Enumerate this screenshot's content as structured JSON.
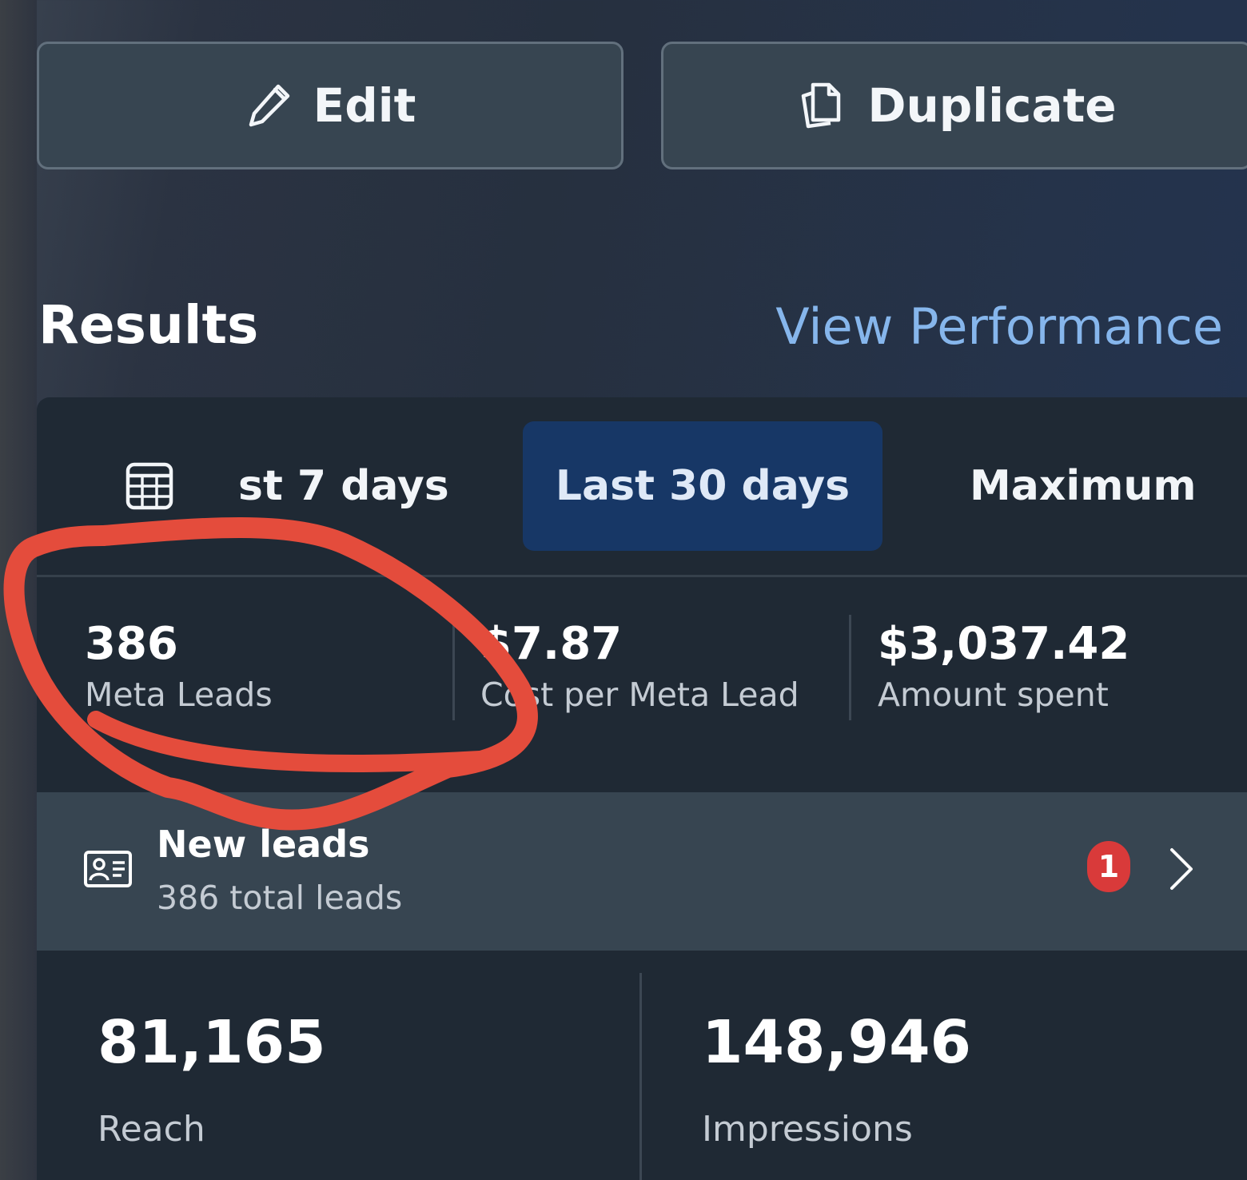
{
  "actions": {
    "edit_label": "Edit",
    "duplicate_label": "Duplicate"
  },
  "results": {
    "title": "Results",
    "view_performance": "View Performance"
  },
  "date_tabs": {
    "last7": "st 7 days",
    "last30": "Last 30 days",
    "maximum": "Maximum",
    "selected": "Last 30 days"
  },
  "metrics": {
    "meta_leads": {
      "value": "386",
      "label": "Meta Leads"
    },
    "cost_per_lead": {
      "value": "$7.87",
      "label": "Cost per Meta Lead"
    },
    "amount_spent": {
      "value": "$3,037.42",
      "label": "Amount spent"
    }
  },
  "new_leads": {
    "title": "New leads",
    "subtitle": "386 total leads",
    "badge_count": "1"
  },
  "reach": {
    "value": "81,165",
    "label": "Reach"
  },
  "impressions": {
    "value": "148,946",
    "label": "Impressions"
  },
  "colors": {
    "accent_link": "#86b6ec",
    "selected_tab": "#173766",
    "badge": "#d93a3a",
    "annotation": "#e44c3c"
  },
  "icons": {
    "edit": "pencil-icon",
    "duplicate": "duplicate-icon",
    "calendar": "calendar-icon",
    "leads": "contact-card-icon",
    "chevron": "chevron-right-icon"
  }
}
